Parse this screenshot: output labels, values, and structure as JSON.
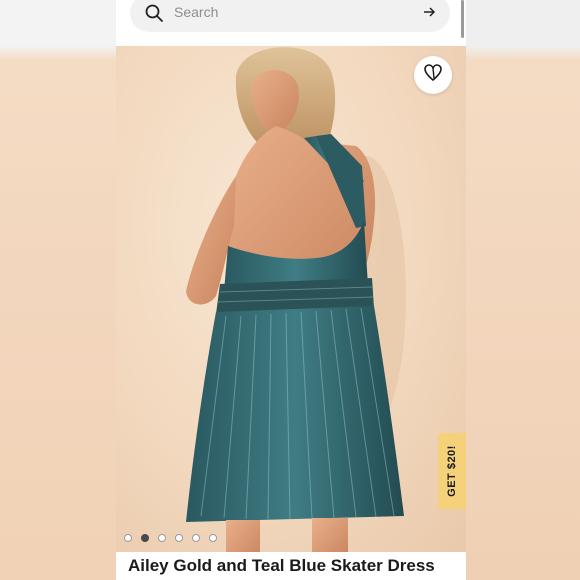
{
  "search": {
    "placeholder": "Search"
  },
  "product": {
    "title": "Ailey Gold and Teal Blue Skater Dress",
    "image_count": 6,
    "active_image": 2
  },
  "promo": {
    "label": "GET $20!"
  },
  "icons": {
    "search": "search-icon",
    "arrow": "arrow-right-icon",
    "favorite": "heart-icon"
  },
  "colors": {
    "accent": "#f5d27a",
    "dress": "#2f5f66"
  }
}
